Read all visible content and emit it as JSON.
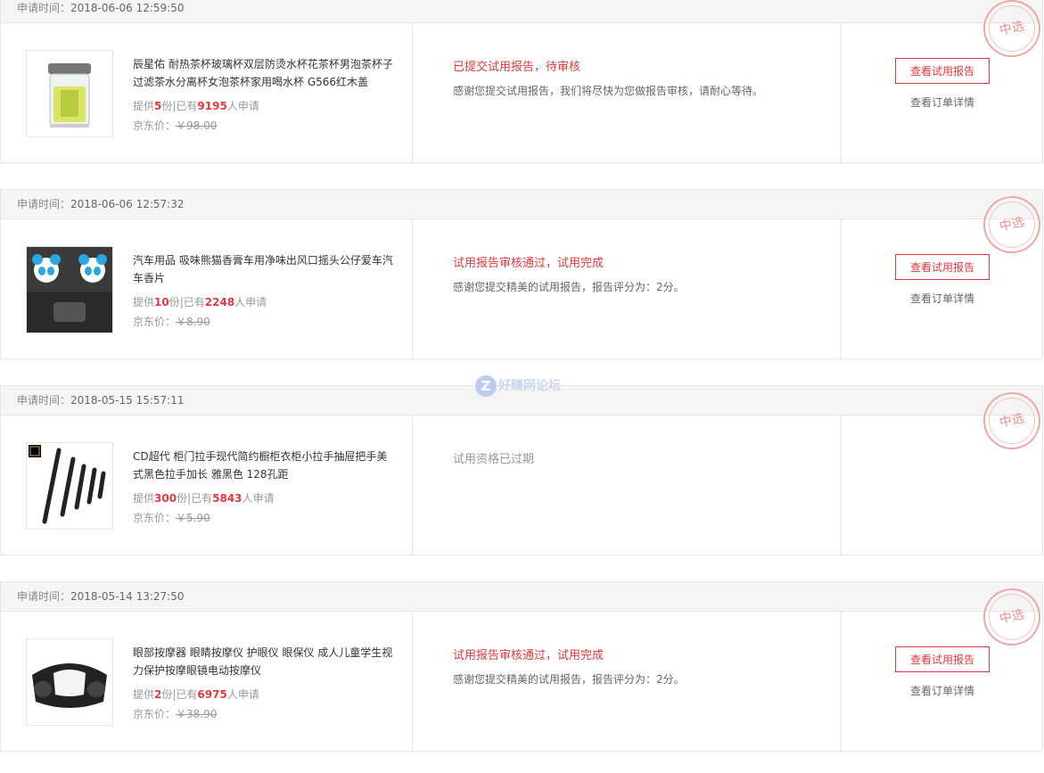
{
  "header_label": "申请时间：",
  "labels": {
    "supply_prefix": "提供",
    "supply_mid": "份|已有",
    "supply_suffix": "人申请",
    "price_prefix": "京东价：",
    "btn_report": "查看试用报告",
    "link_detail": "查看订单详情",
    "stamp": "中选"
  },
  "watermark": {
    "letter": "Z",
    "text": "好赚网论坛"
  },
  "orders": [
    {
      "apply_time": "2018-06-06 12:59:50",
      "name": "辰星佑 耐热茶杯玻璃杯双层防烫水杯花茶杯男泡茶杯子 过滤茶水分离杯女泡茶杯家用喝水杯 G566红木盖",
      "quantity": "5",
      "applicants": "9195",
      "price": "￥98.00",
      "status": "已提交试用报告，待审核",
      "desc": "感谢您提交试用报告，我们将尽快为您做报告审核，请耐心等待。"
    },
    {
      "apply_time": "2018-06-06 12:57:32",
      "name": "汽车用品 吸味熊猫香膏车用净味出风口摇头公仔爱车汽车香片",
      "quantity": "10",
      "applicants": "2248",
      "price": "￥8.90",
      "status": "试用报告审核通过，试用完成",
      "desc": "感谢您提交精美的试用报告，报告评分为：2分。"
    },
    {
      "apply_time": "2018-05-15 15:57:11",
      "name": "CD超代 柜门拉手现代简约橱柜衣柜小拉手抽屉把手美式黑色拉手加长 雅黑色 128孔距",
      "quantity": "300",
      "applicants": "5843",
      "price": "￥5.90",
      "status": "试用资格已过期",
      "desc": ""
    },
    {
      "apply_time": "2018-05-14 13:27:50",
      "name": "眼部按摩器 眼睛按摩仪 护眼仪 眼保仪 成人儿童学生视力保护按摩眼镜电动按摩仪",
      "quantity": "2",
      "applicants": "6975",
      "price": "￥38.90",
      "status": "试用报告审核通过，试用完成",
      "desc": "感谢您提交精美的试用报告，报告评分为：2分。"
    }
  ]
}
